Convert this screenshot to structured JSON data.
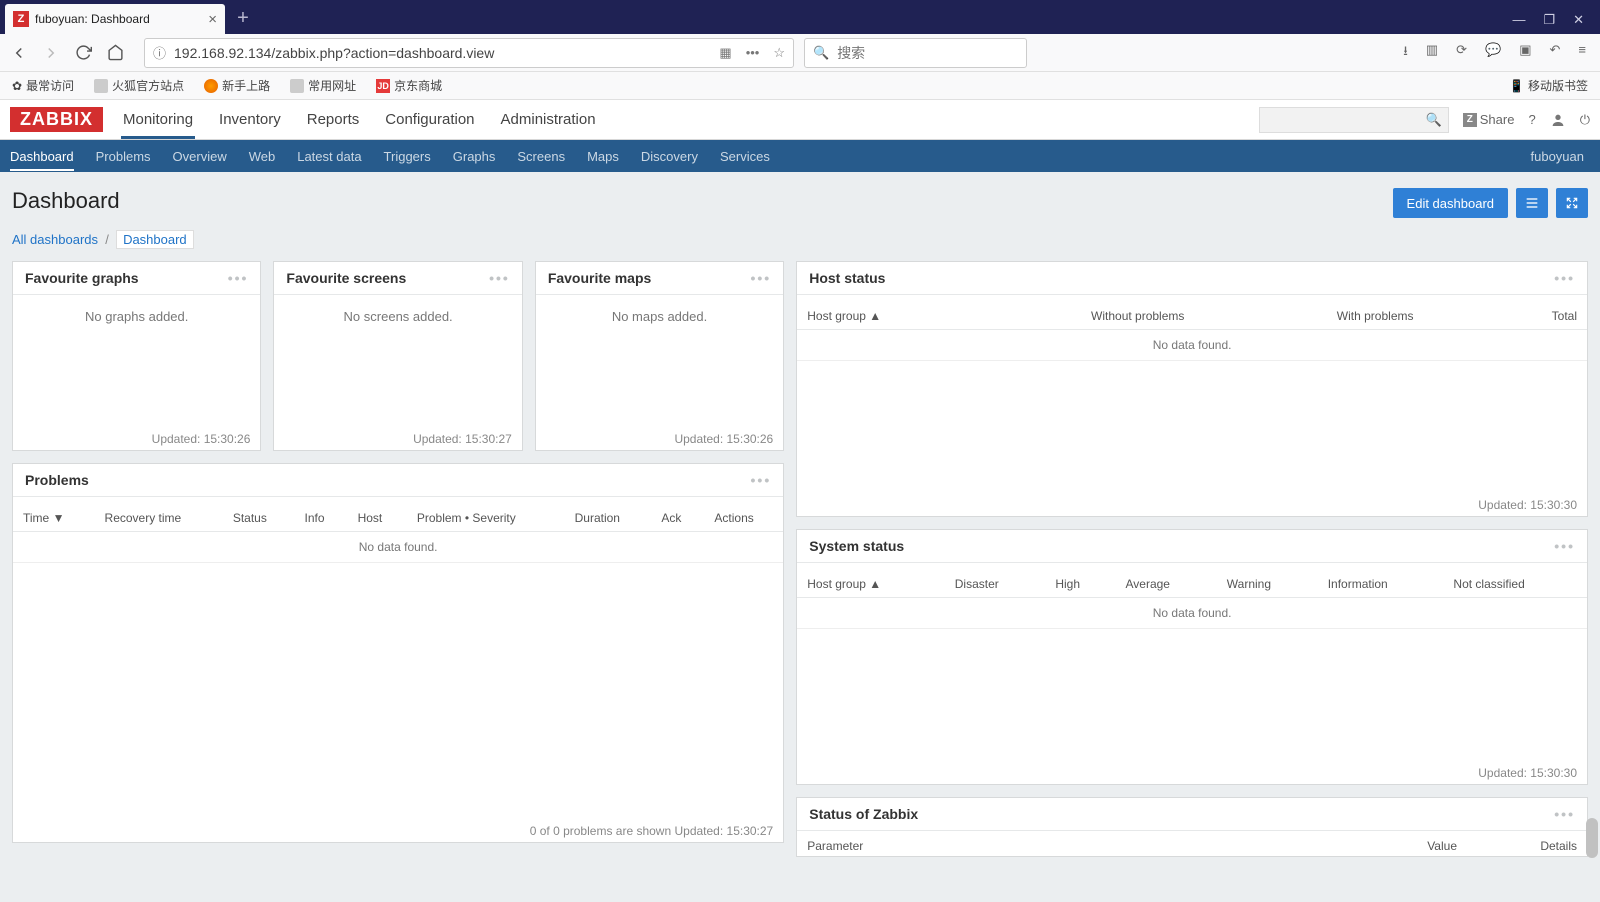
{
  "browser": {
    "tab_title": "fuboyuan: Dashboard",
    "url": "192.168.92.134/zabbix.php?action=dashboard.view",
    "search_placeholder": "搜索",
    "bookmarks": {
      "frequent": "最常访问",
      "firefox_official": "火狐官方站点",
      "newbie": "新手上路",
      "common_urls": "常用网址",
      "jd": "京东商城",
      "mobile_bookmarks": "移动版书签"
    }
  },
  "zabbix": {
    "logo": "ZABBIX",
    "topmenu": [
      "Monitoring",
      "Inventory",
      "Reports",
      "Configuration",
      "Administration"
    ],
    "topmenu_active": 0,
    "share": "Share",
    "submenu": [
      "Dashboard",
      "Problems",
      "Overview",
      "Web",
      "Latest data",
      "Triggers",
      "Graphs",
      "Screens",
      "Maps",
      "Discovery",
      "Services"
    ],
    "submenu_active": 0,
    "user": "fuboyuan"
  },
  "page": {
    "title": "Dashboard",
    "edit_btn": "Edit dashboard",
    "breadcrumb_all": "All dashboards",
    "breadcrumb_current": "Dashboard"
  },
  "widgets": {
    "fav_graphs": {
      "title": "Favourite graphs",
      "empty": "No graphs added.",
      "updated": "Updated: 15:30:26"
    },
    "fav_screens": {
      "title": "Favourite screens",
      "empty": "No screens added.",
      "updated": "Updated: 15:30:27"
    },
    "fav_maps": {
      "title": "Favourite maps",
      "empty": "No maps added.",
      "updated": "Updated: 15:30:26"
    },
    "problems": {
      "title": "Problems",
      "cols": [
        "Time",
        "Recovery time",
        "Status",
        "Info",
        "Host",
        "Problem • Severity",
        "Duration",
        "Ack",
        "Actions"
      ],
      "nodata": "No data found.",
      "footer": "0 of 0 problems are shown    Updated: 15:30:27"
    },
    "host_status": {
      "title": "Host status",
      "cols": [
        "Host group",
        "Without problems",
        "With problems",
        "Total"
      ],
      "nodata": "No data found.",
      "updated": "Updated: 15:30:30"
    },
    "system_status": {
      "title": "System status",
      "cols": [
        "Host group",
        "Disaster",
        "High",
        "Average",
        "Warning",
        "Information",
        "Not classified"
      ],
      "nodata": "No data found.",
      "updated": "Updated: 15:30:30"
    },
    "zabbix_status": {
      "title": "Status of Zabbix",
      "cols": [
        "Parameter",
        "Value",
        "Details"
      ]
    }
  }
}
